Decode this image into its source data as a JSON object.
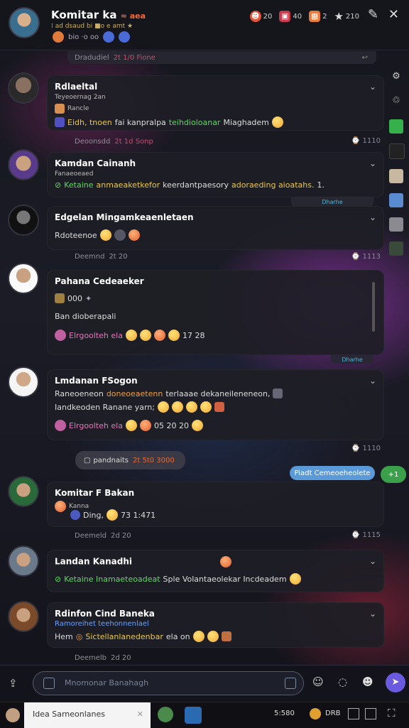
{
  "header": {
    "title": "Komitar ka",
    "title_accent": "≈ aea",
    "subtitle": "⁞ ad dsaud bi ■o e amt ★",
    "meta": "bio ·o oo",
    "stats": [
      {
        "icon": "flame-icon",
        "value": "20",
        "color": "#e8543a"
      },
      {
        "icon": "gift-icon",
        "value": "40",
        "color": "#c83a4a"
      },
      {
        "icon": "box-icon",
        "value": "2",
        "color": "#e87a3a"
      },
      {
        "icon": "star-icon",
        "value": "210",
        "color": "#cccccc"
      }
    ]
  },
  "separators": [
    {
      "text": "Dradudiel",
      "highlight": "2t 1/0 Fione",
      "tail": "↩"
    },
    {
      "text": "Deoonsdd",
      "highlight": "2t 1d Sonp",
      "tail": ""
    },
    {
      "text": "Deemnd",
      "highlight": "2t 20",
      "tail": ""
    },
    {
      "text": "Deemeld",
      "highlight": "2d 20",
      "tail": ""
    },
    {
      "text": "Deemelb",
      "highlight": "2d 20",
      "tail": ""
    }
  ],
  "meta_times": [
    "1110",
    "1113",
    "1110",
    "1115"
  ],
  "messages": [
    {
      "name": "Rdlaeltal",
      "line1": "Teyeoernag 2an",
      "line2_label": "Rancle",
      "line2_text": "Eidh, tnoen",
      "line2_rest": "fai kanpralpa",
      "line2_green": "teihdioloanar",
      "line2_end": "Miaghadem"
    },
    {
      "name": "Kamdan Cainanh",
      "sub": "Fanaeoeaed",
      "green": "Ketaine",
      "yellow": "anmaeaketkefor",
      "text": "keerdantpaesory",
      "yellow2": "adoraeding aioatahs.",
      "end": "1."
    },
    {
      "name": "Edgelan Mingamkeaenletaen",
      "text": "Rdoteenoe"
    },
    {
      "name": "Pahana Cedeaeker",
      "line1": "000",
      "line2": "Ban dioberapali",
      "reactions_label": "Elrgoolteh ela",
      "nums": "17 28"
    },
    {
      "name": "Lmdanan FSogon",
      "line1_a": "Raneoeneon",
      "line1_b": "doneoeaetenn",
      "line1_c": "terlaaae dekaneileneneon,",
      "line2": "Iandkeoden Ranane yarn;",
      "reactions_label": "Elrgoolteh ela",
      "nums": "05 20 20"
    },
    {
      "name": "Komitar F Bakan",
      "line1": "Kanna",
      "line2": "Ding,",
      "nums": "73 1:471"
    },
    {
      "name": "Landan Kanadhi",
      "green": "Ketaine Inamaeteoadeat",
      "text": "Sple Volantaeolekar Incdeadem"
    },
    {
      "name": "Rdinfon Cind Baneka",
      "sub": "Ramoreihet teehonnenlael",
      "text_a": "Hem",
      "text_b": "Sictellanlanedenbar",
      "text_c": "ela on"
    }
  ],
  "date_pill": {
    "text": "pandnaits",
    "highlight": "2t 5t0 3000"
  },
  "blue_pill": "Piadt Cemeoeheolete",
  "green_pill": "+1",
  "small_blue_label": "Dharhe",
  "small_blue_label2": "Dharhe",
  "input": {
    "placeholder": "Mnomonar Banahagh"
  },
  "taskbar": {
    "field": "Idea Sarneonlanes",
    "tray": "5:580",
    "tray2": "DRB"
  }
}
